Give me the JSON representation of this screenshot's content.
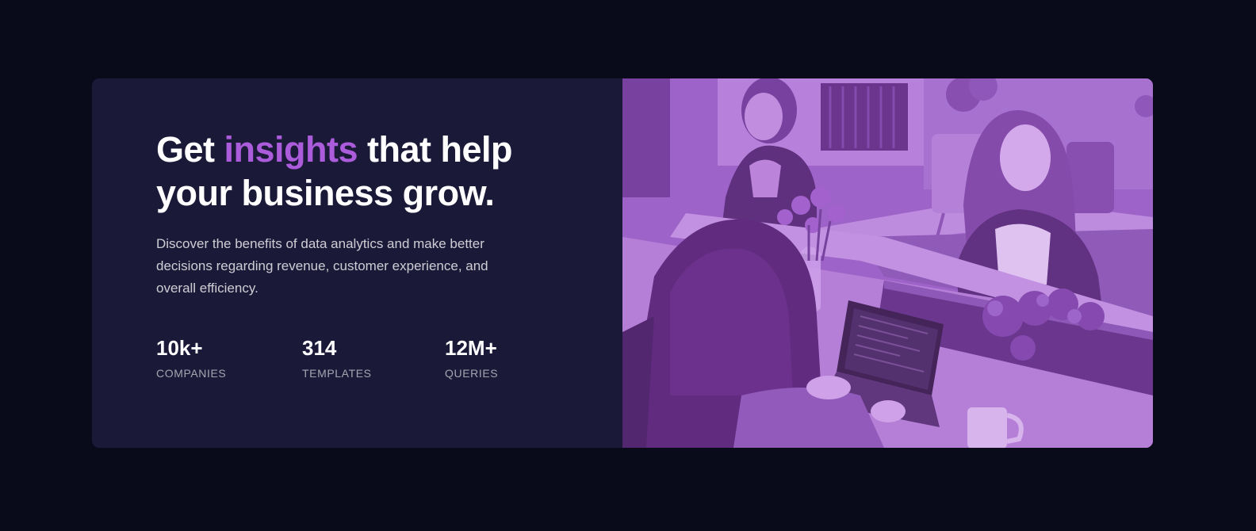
{
  "headline": {
    "before": "Get ",
    "accent": "insights",
    "after": " that help your business grow."
  },
  "description": "Discover the benefits of data analytics and make better decisions regarding revenue, customer experience, and overall efficiency.",
  "stats": [
    {
      "value": "10k+",
      "label": "COMPANIES"
    },
    {
      "value": "314",
      "label": "TEMPLATES"
    },
    {
      "value": "12M+",
      "label": "QUERIES"
    }
  ],
  "colors": {
    "page_background": "#090b1a",
    "card_background": "#1b1938",
    "accent": "#aa5cdb",
    "image_overlay": "#aa5cdb"
  },
  "image": {
    "subject": "office-team-photo",
    "tint": "purple"
  }
}
